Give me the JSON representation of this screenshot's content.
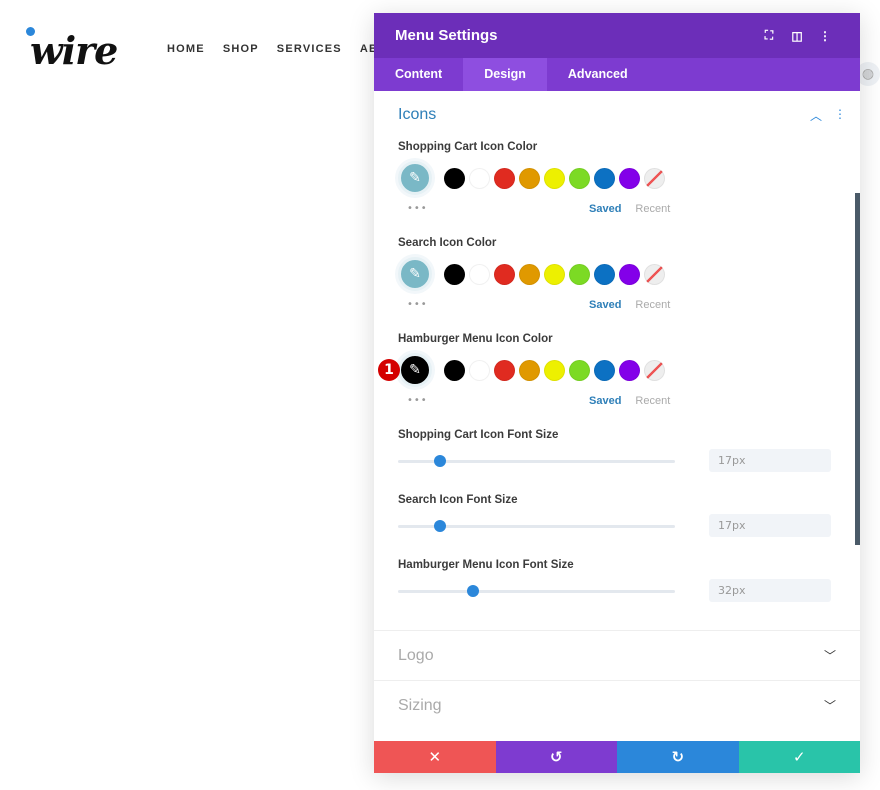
{
  "site": {
    "logo": "wire",
    "nav": [
      "HOME",
      "SHOP",
      "SERVICES",
      "ABO"
    ]
  },
  "panel": {
    "title": "Menu Settings",
    "tabs": [
      "Content",
      "Design",
      "Advanced"
    ],
    "active_tab": "Design",
    "section": "Icons",
    "color_fields": [
      {
        "label": "Shopping Cart Icon Color",
        "current": "#7ab8c6"
      },
      {
        "label": "Search Icon Color",
        "current": "#7ab8c6"
      },
      {
        "label": "Hamburger Menu Icon Color",
        "current": "#000000",
        "badge": "1"
      }
    ],
    "swatches": [
      "#000000",
      "#ffffff",
      "#e02b20",
      "#e09900",
      "#edf000",
      "#7cda24",
      "#0c71c3",
      "#8300e9"
    ],
    "saved_label": "Saved",
    "recent_label": "Recent",
    "sliders": [
      {
        "label": "Shopping Cart Icon Font Size",
        "value": "17px",
        "fraction": 0.15
      },
      {
        "label": "Search Icon Font Size",
        "value": "17px",
        "fraction": 0.15
      },
      {
        "label": "Hamburger Menu Icon Font Size",
        "value": "32px",
        "fraction": 0.27
      }
    ],
    "collapsed": [
      "Logo",
      "Sizing"
    ],
    "colors": {
      "header": "#6c2eb9",
      "tabs": "#7d3bd0",
      "cancel": "#ef5555",
      "undo": "#7e3bd0",
      "redo": "#2b87da",
      "save": "#29c4a9"
    }
  }
}
